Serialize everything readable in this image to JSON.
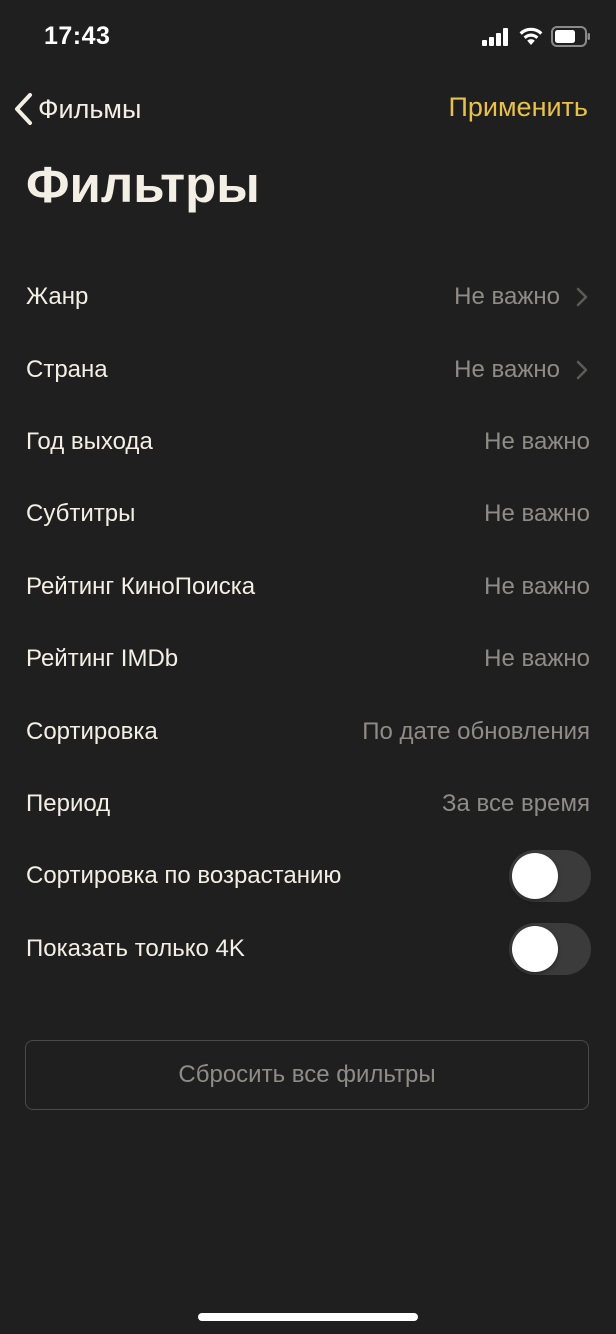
{
  "status_bar": {
    "time": "17:43",
    "signal_icon": "cellular-signal-icon",
    "wifi_icon": "wifi-icon",
    "battery_icon": "battery-icon"
  },
  "nav": {
    "back_label": "Фильмы",
    "back_icon": "chevron-left-icon",
    "apply_label": "Применить",
    "accent_color": "#e9c14a"
  },
  "title": "Фильтры",
  "filters": [
    {
      "label": "Жанр",
      "value": "Не важно",
      "chevron": true
    },
    {
      "label": "Страна",
      "value": "Не важно",
      "chevron": true
    },
    {
      "label": "Год выхода",
      "value": "Не важно"
    },
    {
      "label": "Субтитры",
      "value": "Не важно"
    },
    {
      "label": "Рейтинг КиноПоиска",
      "value": "Не важно"
    },
    {
      "label": "Рейтинг IMDb",
      "value": "Не важно"
    },
    {
      "label": "Сортировка",
      "value": "По дате обновления"
    },
    {
      "label": "Период",
      "value": "За все время"
    }
  ],
  "toggles": [
    {
      "label": "Сортировка по возрастанию",
      "on": false
    },
    {
      "label": "Показать только 4K",
      "on": false
    }
  ],
  "reset_label": "Сбросить все фильтры"
}
